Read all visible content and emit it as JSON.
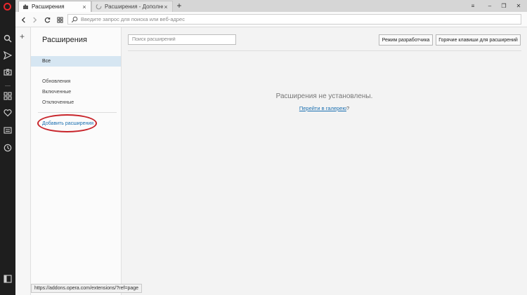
{
  "tabs": [
    {
      "title": "Расширения",
      "close": "×"
    },
    {
      "title": "Расширения - Дополне",
      "close": "×"
    }
  ],
  "new_tab_label": "+",
  "window_controls": {
    "stash": "≡",
    "minimize": "–",
    "restore": "❐",
    "close": "✕"
  },
  "address_bar": {
    "placeholder": "Введите запрос для поиска или веб-адрес",
    "value": ""
  },
  "sidebar_add": "+",
  "extensions_nav": {
    "title": "Расширения",
    "all": "Все",
    "items": [
      "Обновления",
      "Включенные",
      "Отключенные"
    ],
    "add_link": "Добавить расширения"
  },
  "main": {
    "search_placeholder": "Поиск расширений",
    "dev_mode_button": "Режим разработчика",
    "hotkeys_button": "Горячие клавиши для расширений",
    "empty_message": "Расширения не установлены.",
    "gallery_link": "Перейти в галерею",
    "gallery_suffix": "?"
  },
  "status_url": "https://addons.opera.com/extensions/?ref=page",
  "colors": {
    "opera_red": "#e8272c",
    "accent_blue": "#1a6fb0",
    "highlight_red": "#c8242a",
    "selected_bg": "#d6e6f2"
  }
}
